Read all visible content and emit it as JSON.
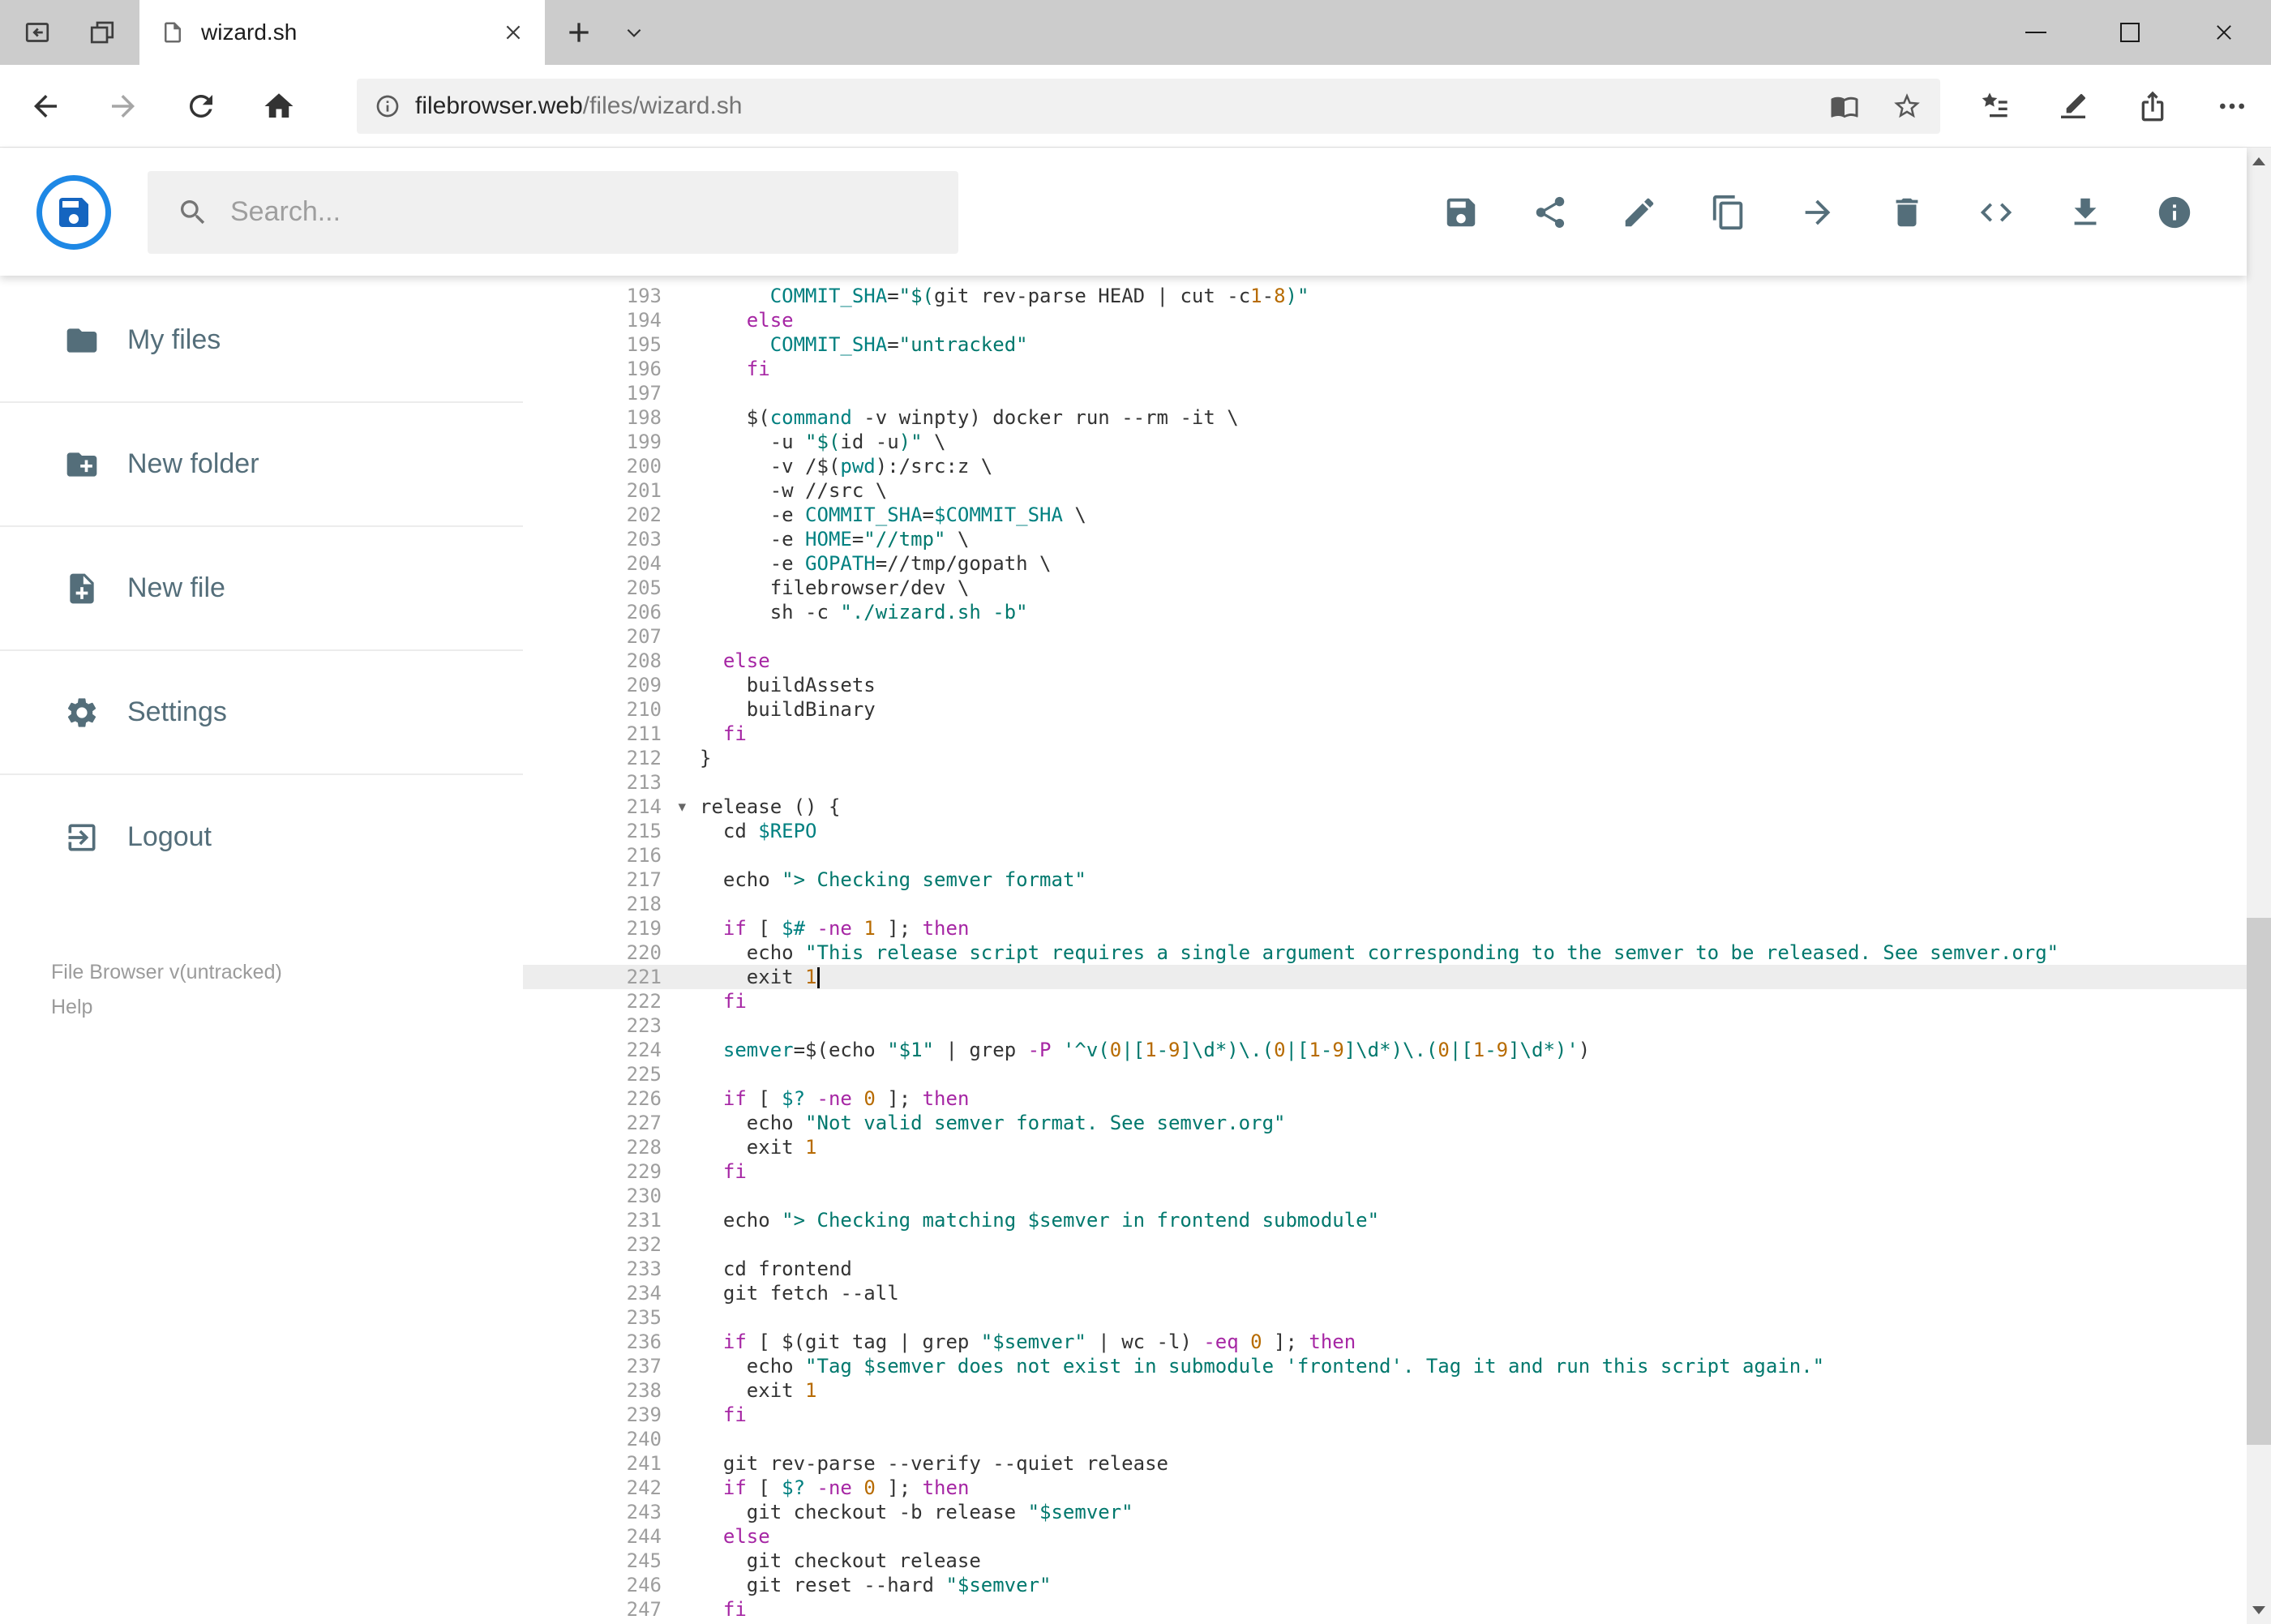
{
  "browser": {
    "tab": {
      "title": "wizard.sh"
    },
    "url": {
      "host": "filebrowser.web",
      "path": "/files/wizard.sh"
    }
  },
  "header": {
    "search": {
      "placeholder": "Search..."
    },
    "actions": [
      "save",
      "share",
      "rename",
      "copy",
      "move",
      "delete",
      "raw-view",
      "download",
      "info"
    ]
  },
  "sidebar": {
    "items": [
      {
        "icon": "folder",
        "label": "My files"
      },
      {
        "icon": "create-new-folder",
        "label": "New folder"
      },
      {
        "icon": "note-add",
        "label": "New file"
      },
      {
        "icon": "settings-gear",
        "label": "Settings"
      },
      {
        "icon": "logout",
        "label": "Logout"
      }
    ],
    "footer": {
      "version": "File Browser v(untracked)",
      "help": "Help"
    }
  },
  "icons": {
    "fold_arrow": "▾"
  },
  "editor": {
    "language": "shell",
    "active_line": 221,
    "cursor_line": 221,
    "fold_line": 214,
    "syntax_colors": {
      "plain": "#333333",
      "keyword": "#a626a4",
      "string": "#00786d",
      "variable": "#008080",
      "number": "#b76b01"
    },
    "lines": [
      {
        "n": 193,
        "t": [
          [
            "p",
            "      "
          ],
          [
            "v",
            "COMMIT_SHA"
          ],
          [
            "p",
            "="
          ],
          [
            "s",
            "\"$("
          ],
          [
            "p",
            "git rev-parse HEAD | cut -c"
          ],
          [
            "n",
            "1"
          ],
          [
            "p",
            "-"
          ],
          [
            "n",
            "8"
          ],
          [
            "s",
            ")\""
          ]
        ]
      },
      {
        "n": 194,
        "t": [
          [
            "p",
            "    "
          ],
          [
            "k",
            "else"
          ]
        ]
      },
      {
        "n": 195,
        "t": [
          [
            "p",
            "      "
          ],
          [
            "v",
            "COMMIT_SHA"
          ],
          [
            "p",
            "="
          ],
          [
            "s",
            "\"untracked\""
          ]
        ]
      },
      {
        "n": 196,
        "t": [
          [
            "p",
            "    "
          ],
          [
            "k",
            "fi"
          ]
        ]
      },
      {
        "n": 197,
        "t": []
      },
      {
        "n": 198,
        "t": [
          [
            "p",
            "    $("
          ],
          [
            "v",
            "command"
          ],
          [
            "p",
            " -v winpty) docker run --rm -it \\"
          ]
        ]
      },
      {
        "n": 199,
        "t": [
          [
            "p",
            "      -u "
          ],
          [
            "s",
            "\"$("
          ],
          [
            "p",
            "id -u"
          ],
          [
            "s",
            ")\""
          ],
          [
            "p",
            " \\"
          ]
        ]
      },
      {
        "n": 200,
        "t": [
          [
            "p",
            "      -v /$("
          ],
          [
            "v",
            "pwd"
          ],
          [
            "p",
            "):/src:z \\"
          ]
        ]
      },
      {
        "n": 201,
        "t": [
          [
            "p",
            "      -w //src \\"
          ]
        ]
      },
      {
        "n": 202,
        "t": [
          [
            "p",
            "      -e "
          ],
          [
            "v",
            "COMMIT_SHA"
          ],
          [
            "p",
            "="
          ],
          [
            "v",
            "$COMMIT_SHA"
          ],
          [
            "p",
            " \\"
          ]
        ]
      },
      {
        "n": 203,
        "t": [
          [
            "p",
            "      -e "
          ],
          [
            "v",
            "HOME"
          ],
          [
            "p",
            "="
          ],
          [
            "s",
            "\"//tmp\""
          ],
          [
            "p",
            " \\"
          ]
        ]
      },
      {
        "n": 204,
        "t": [
          [
            "p",
            "      -e "
          ],
          [
            "v",
            "GOPATH"
          ],
          [
            "p",
            "=//tmp/gopath \\"
          ]
        ]
      },
      {
        "n": 205,
        "t": [
          [
            "p",
            "      filebrowser/dev \\"
          ]
        ]
      },
      {
        "n": 206,
        "t": [
          [
            "p",
            "      sh -c "
          ],
          [
            "s",
            "\"./wizard.sh -b\""
          ]
        ]
      },
      {
        "n": 207,
        "t": []
      },
      {
        "n": 208,
        "t": [
          [
            "p",
            "  "
          ],
          [
            "k",
            "else"
          ]
        ]
      },
      {
        "n": 209,
        "t": [
          [
            "p",
            "    buildAssets"
          ]
        ]
      },
      {
        "n": 210,
        "t": [
          [
            "p",
            "    buildBinary"
          ]
        ]
      },
      {
        "n": 211,
        "t": [
          [
            "p",
            "  "
          ],
          [
            "k",
            "fi"
          ]
        ]
      },
      {
        "n": 212,
        "t": [
          [
            "p",
            "}"
          ]
        ]
      },
      {
        "n": 213,
        "t": []
      },
      {
        "n": 214,
        "t": [
          [
            "p",
            "release () {"
          ]
        ]
      },
      {
        "n": 215,
        "t": [
          [
            "p",
            "  cd "
          ],
          [
            "v",
            "$REPO"
          ]
        ]
      },
      {
        "n": 216,
        "t": []
      },
      {
        "n": 217,
        "t": [
          [
            "p",
            "  echo "
          ],
          [
            "s",
            "\"> Checking semver format\""
          ]
        ]
      },
      {
        "n": 218,
        "t": []
      },
      {
        "n": 219,
        "t": [
          [
            "p",
            "  "
          ],
          [
            "k",
            "if"
          ],
          [
            "p",
            " [ "
          ],
          [
            "v",
            "$#"
          ],
          [
            "p",
            " "
          ],
          [
            "k",
            "-ne"
          ],
          [
            "p",
            " "
          ],
          [
            "n",
            "1"
          ],
          [
            "p",
            " ]; "
          ],
          [
            "k",
            "then"
          ]
        ]
      },
      {
        "n": 220,
        "t": [
          [
            "p",
            "    echo "
          ],
          [
            "s",
            "\"This release script requires a single argument corresponding to the semver to be released. See semver.org\""
          ]
        ]
      },
      {
        "n": 221,
        "t": [
          [
            "p",
            "    exit "
          ],
          [
            "n",
            "1"
          ]
        ]
      },
      {
        "n": 222,
        "t": [
          [
            "p",
            "  "
          ],
          [
            "k",
            "fi"
          ]
        ]
      },
      {
        "n": 223,
        "t": []
      },
      {
        "n": 224,
        "t": [
          [
            "p",
            "  "
          ],
          [
            "v",
            "semver"
          ],
          [
            "p",
            "=$(echo "
          ],
          [
            "s",
            "\"$1\""
          ],
          [
            "p",
            " | grep "
          ],
          [
            "k",
            "-P"
          ],
          [
            "p",
            " "
          ],
          [
            "s",
            "'^v("
          ],
          [
            "n",
            "0"
          ],
          [
            "s",
            "|["
          ],
          [
            "n",
            "1"
          ],
          [
            "s",
            "-"
          ],
          [
            "n",
            "9"
          ],
          [
            "s",
            "]\\d*)\\.("
          ],
          [
            "n",
            "0"
          ],
          [
            "s",
            "|["
          ],
          [
            "n",
            "1"
          ],
          [
            "s",
            "-"
          ],
          [
            "n",
            "9"
          ],
          [
            "s",
            "]\\d*)\\.("
          ],
          [
            "n",
            "0"
          ],
          [
            "s",
            "|["
          ],
          [
            "n",
            "1"
          ],
          [
            "s",
            "-"
          ],
          [
            "n",
            "9"
          ],
          [
            "s",
            "]\\d*)'"
          ],
          [
            "p",
            ")"
          ]
        ]
      },
      {
        "n": 225,
        "t": []
      },
      {
        "n": 226,
        "t": [
          [
            "p",
            "  "
          ],
          [
            "k",
            "if"
          ],
          [
            "p",
            " [ "
          ],
          [
            "v",
            "$?"
          ],
          [
            "p",
            " "
          ],
          [
            "k",
            "-ne"
          ],
          [
            "p",
            " "
          ],
          [
            "n",
            "0"
          ],
          [
            "p",
            " ]; "
          ],
          [
            "k",
            "then"
          ]
        ]
      },
      {
        "n": 227,
        "t": [
          [
            "p",
            "    echo "
          ],
          [
            "s",
            "\"Not valid semver format. See semver.org\""
          ]
        ]
      },
      {
        "n": 228,
        "t": [
          [
            "p",
            "    exit "
          ],
          [
            "n",
            "1"
          ]
        ]
      },
      {
        "n": 229,
        "t": [
          [
            "p",
            "  "
          ],
          [
            "k",
            "fi"
          ]
        ]
      },
      {
        "n": 230,
        "t": []
      },
      {
        "n": 231,
        "t": [
          [
            "p",
            "  echo "
          ],
          [
            "s",
            "\"> Checking matching $semver in frontend submodule\""
          ]
        ]
      },
      {
        "n": 232,
        "t": []
      },
      {
        "n": 233,
        "t": [
          [
            "p",
            "  cd frontend"
          ]
        ]
      },
      {
        "n": 234,
        "t": [
          [
            "p",
            "  git fetch --all"
          ]
        ]
      },
      {
        "n": 235,
        "t": []
      },
      {
        "n": 236,
        "t": [
          [
            "p",
            "  "
          ],
          [
            "k",
            "if"
          ],
          [
            "p",
            " [ $(git tag | grep "
          ],
          [
            "s",
            "\"$semver\""
          ],
          [
            "p",
            " | wc -l) "
          ],
          [
            "k",
            "-eq"
          ],
          [
            "p",
            " "
          ],
          [
            "n",
            "0"
          ],
          [
            "p",
            " ]; "
          ],
          [
            "k",
            "then"
          ]
        ]
      },
      {
        "n": 237,
        "t": [
          [
            "p",
            "    echo "
          ],
          [
            "s",
            "\"Tag $semver does not exist in submodule 'frontend'. Tag it and run this script again.\""
          ]
        ]
      },
      {
        "n": 238,
        "t": [
          [
            "p",
            "    exit "
          ],
          [
            "n",
            "1"
          ]
        ]
      },
      {
        "n": 239,
        "t": [
          [
            "p",
            "  "
          ],
          [
            "k",
            "fi"
          ]
        ]
      },
      {
        "n": 240,
        "t": []
      },
      {
        "n": 241,
        "t": [
          [
            "p",
            "  git rev-parse --verify --quiet release"
          ]
        ]
      },
      {
        "n": 242,
        "t": [
          [
            "p",
            "  "
          ],
          [
            "k",
            "if"
          ],
          [
            "p",
            " [ "
          ],
          [
            "v",
            "$?"
          ],
          [
            "p",
            " "
          ],
          [
            "k",
            "-ne"
          ],
          [
            "p",
            " "
          ],
          [
            "n",
            "0"
          ],
          [
            "p",
            " ]; "
          ],
          [
            "k",
            "then"
          ]
        ]
      },
      {
        "n": 243,
        "t": [
          [
            "p",
            "    git checkout -b release "
          ],
          [
            "s",
            "\"$semver\""
          ]
        ]
      },
      {
        "n": 244,
        "t": [
          [
            "p",
            "  "
          ],
          [
            "k",
            "else"
          ]
        ]
      },
      {
        "n": 245,
        "t": [
          [
            "p",
            "    git checkout release"
          ]
        ]
      },
      {
        "n": 246,
        "t": [
          [
            "p",
            "    git reset --hard "
          ],
          [
            "s",
            "\"$semver\""
          ]
        ]
      },
      {
        "n": 247,
        "t": [
          [
            "p",
            "  "
          ],
          [
            "k",
            "fi"
          ]
        ]
      }
    ]
  }
}
